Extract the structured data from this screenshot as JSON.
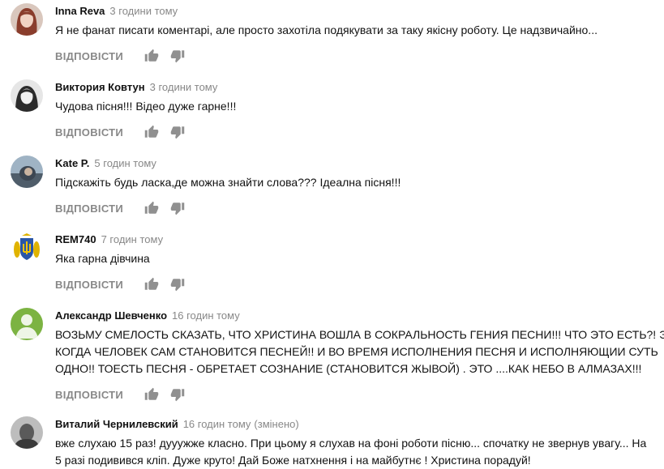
{
  "comments": [
    {
      "author": "Inna Reva",
      "time": "3 години тому",
      "edited": "",
      "lines": [
        "Я не фанат писати коментарі, але просто захотіла подякувати за таку якісну роботу. Це надзвичайно..."
      ],
      "reply": "ВІДПОВІСТИ",
      "avatar_color": "#8a4a3a",
      "avatar": "avatar-woman-red-hair"
    },
    {
      "author": "Виктория Ковтун",
      "time": "3 години тому",
      "edited": "",
      "lines": [
        "Чудова пісня!!! Відео дуже гарне!!!"
      ],
      "reply": "ВІДПОВІСТИ",
      "avatar_color": "#dcdcdc",
      "avatar": "avatar-woman-bw"
    },
    {
      "author": "Kate P.",
      "time": "5 годин тому",
      "edited": "",
      "lines": [
        "Підскажіть будь ласка,де можна знайти слова??? Ідеална пісня!!!"
      ],
      "reply": "ВІДПОВІСТИ",
      "avatar_color": "#6a8196",
      "avatar": "avatar-photo"
    },
    {
      "author": "REM740",
      "time": "7 годин тому",
      "edited": "",
      "lines": [
        "Яка гарна дівчина"
      ],
      "reply": "ВІДПОВІСТИ",
      "avatar_color": "#2a56a8",
      "avatar": "avatar-coat-of-arms"
    },
    {
      "author": "Александр Шевченко",
      "time": "16 годин тому",
      "edited": "",
      "lines": [
        "ВОЗЬМУ СМЕЛОСТЬ СКАЗАТЬ, ЧТО ХРИСТИНА ВОШЛА В СОКРАЛЬНОСТЬ ГЕНИЯ ПЕСНИ!!! ЧТО ЭТО ЕСТЬ?!  ЭТО",
        "КОГДА ЧЕЛОВЕК САМ СТАНОВИТСЯ  ПЕСНЕЙ!! И ВО ВРЕМЯ ИСПОЛНЕНИЯ ПЕСНЯ И ИСПОЛНЯЮЩИИ СУТЬ",
        "ОДНО!! ТОЕСТЬ ПЕСНЯ  - ОБРЕТАЕТ СОЗНАНИЕ (СТАНОВИТСЯ ЖЫВОЙ) . ЭТО ....КАК НЕБО В АЛМАЗАХ!!!"
      ],
      "reply": "ВІДПОВІСТИ",
      "avatar_color": "#7cb342",
      "avatar": "avatar-default-green"
    },
    {
      "author": "Виталий Чернилевский",
      "time": "16 годин тому",
      "edited": "(змінено)",
      "lines": [
        "вже слухаю 15 раз! дууужже класно. При цьому я слухав на фоні роботи пісню... спочатку не звернув увагу... На",
        "5 разі подивився кліп. Дуже круто! Дай Боже  натхнення і на майбутнє ! Христина порадуй!"
      ],
      "reply": "",
      "avatar_color": "#777777",
      "avatar": "avatar-man-bw"
    }
  ]
}
